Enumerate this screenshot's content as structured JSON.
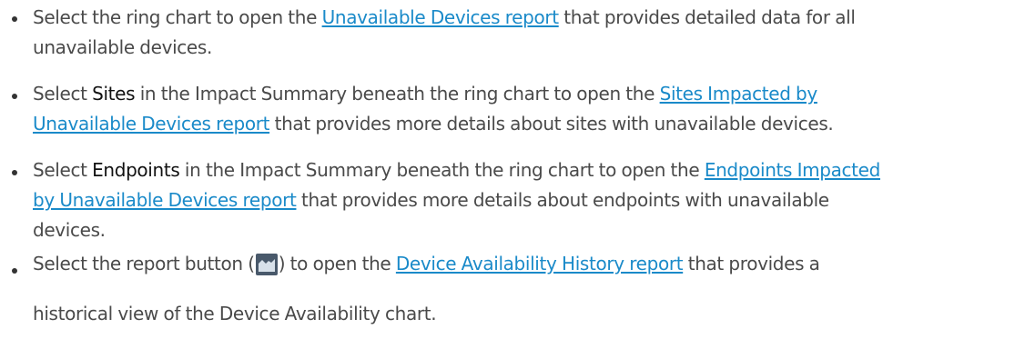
{
  "bullets": [
    {
      "before": "Select the ring chart to open the ",
      "link": "Unavailable Devices report",
      "after": " that provides detailed data for all",
      "line2": "unavailable devices."
    },
    {
      "before": "Select ",
      "bold": "Sites",
      "middle": " in the Impact Summary beneath the ring chart to open the ",
      "link_part1": "Sites Impacted by",
      "link_part2": "Unavailable Devices report",
      "after": " that provides more details about sites with unavailable devices."
    },
    {
      "before": "Select ",
      "bold": "Endpoints",
      "middle": " in the Impact Summary beneath the ring chart to open the ",
      "link_part1": "Endpoints Impacted",
      "link_part2": "by Unavailable Devices report",
      "after": " that provides more details about endpoints with unavailable",
      "line3": "devices."
    },
    {
      "before": "Select the report button (",
      "icon": "area-chart-icon",
      "middle": ") to open the ",
      "link": "Device Availability History report",
      "after": " that provides a",
      "line2": "historical view of the Device Availability chart."
    }
  ],
  "colors": {
    "text": "#4a4a4a",
    "link": "#1a8ac9",
    "emphasis": "#111111",
    "icon_background": "#49596b"
  }
}
